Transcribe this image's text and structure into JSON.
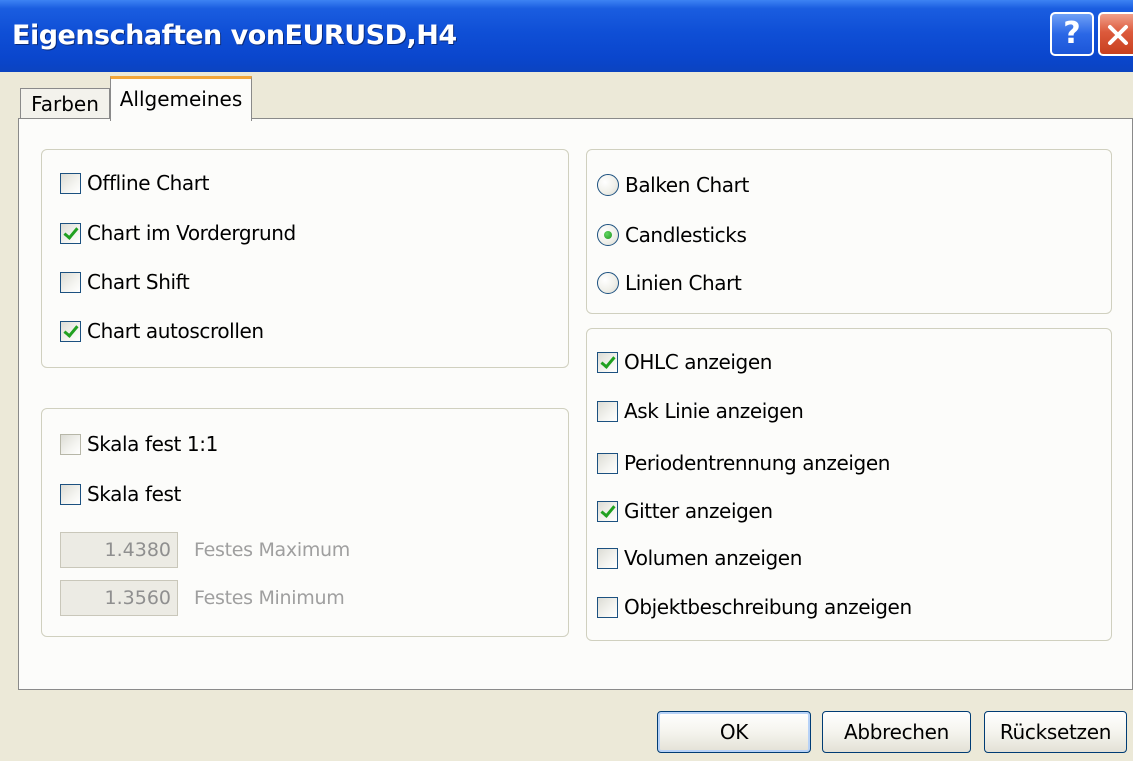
{
  "window": {
    "title": "Eigenschaften vonEURUSD,H4",
    "help_glyph": "?",
    "close_glyph": "x"
  },
  "tabs": [
    {
      "label": "Farben",
      "active": false
    },
    {
      "label": "Allgemeines",
      "active": true
    }
  ],
  "chart_options": [
    {
      "label": "Offline Chart",
      "checked": false
    },
    {
      "label": "Chart im Vordergrund",
      "checked": true
    },
    {
      "label": "Chart Shift",
      "checked": false
    },
    {
      "label": "Chart autoscrollen",
      "checked": true
    }
  ],
  "scale_options": {
    "fixed_1_1": {
      "label": "Skala fest 1:1",
      "checked": false
    },
    "fixed": {
      "label": "Skala fest",
      "checked": false
    },
    "max": {
      "value": "1.4380",
      "label": "Festes Maximum",
      "enabled": false
    },
    "min": {
      "value": "1.3560",
      "label": "Festes Minimum",
      "enabled": false
    }
  },
  "chart_type": {
    "options": [
      {
        "label": "Balken Chart",
        "selected": false
      },
      {
        "label": "Candlesticks",
        "selected": true
      },
      {
        "label": "Linien Chart",
        "selected": false
      }
    ]
  },
  "display_options": [
    {
      "label": "OHLC anzeigen",
      "checked": true
    },
    {
      "label": "Ask Linie anzeigen",
      "checked": false
    },
    {
      "label": "Periodentrennung anzeigen",
      "checked": false
    },
    {
      "label": "Gitter anzeigen",
      "checked": true
    },
    {
      "label": "Volumen anzeigen",
      "checked": false
    },
    {
      "label": "Objektbeschreibung anzeigen",
      "checked": false
    }
  ],
  "buttons": {
    "ok": "OK",
    "cancel": "Abbrechen",
    "reset": "Rücksetzen"
  },
  "colors": {
    "titlebar": "#0f4fd6",
    "dialog_bg": "#ece9d8",
    "panel_bg": "#fcfcfa",
    "check_mark": "#21a121",
    "active_tab_accent": "#f3a63a",
    "close_button": "#dc5a3c"
  },
  "icons": {
    "help": "help-icon",
    "close": "close-icon",
    "check": "checkmark-icon",
    "radio": "radio-dot-icon"
  }
}
